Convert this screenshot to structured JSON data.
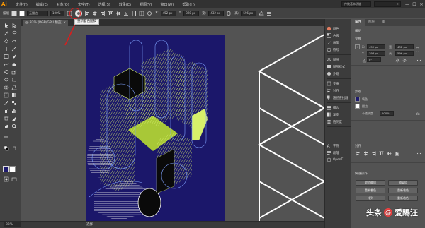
{
  "app": {
    "logo_text": "Ai",
    "menus": [
      "文件(F)",
      "编辑(E)",
      "对象(O)",
      "文字(T)",
      "选择(S)",
      "效果(C)",
      "视图(V)",
      "窗口(W)",
      "帮助(H)"
    ],
    "workspace": "传统基本功能",
    "window_controls": [
      "—",
      "☐",
      "✕"
    ]
  },
  "controlbar": {
    "label": "编组",
    "stroke_profile": "无描边",
    "opacity": "100%",
    "x": "452 px",
    "y": "398 px",
    "w": "432 px",
    "h": "596 px"
  },
  "tooltip": "重新着色图稿",
  "document_tab": {
    "title": "@ 33% (RGB/GPU 预览)",
    "close": "×"
  },
  "status": {
    "zoom": "33%",
    "tool": "选择"
  },
  "dock": {
    "items": [
      "颜色",
      "色板",
      "画笔",
      "符号",
      "图层",
      "图形样式",
      "外观",
      "变换",
      "对齐",
      "路径查找器",
      "描边",
      "渐变",
      "透明度",
      "字符",
      "段落",
      "OpenT..."
    ]
  },
  "props": {
    "tabs": [
      "属性",
      "图层",
      "库"
    ],
    "section_group": "编组",
    "section_transform": "变换",
    "transform": {
      "x_label": "X:",
      "x": "452 px",
      "y_label": "Y:",
      "y": "398 px",
      "w_label": "宽:",
      "w": "432 px",
      "h_label": "高:",
      "h": "596 px",
      "angle": "0°"
    },
    "section_appearance": "外观",
    "fill_label": "填色",
    "stroke_label": "描边",
    "opacity_label": "不透明度",
    "opacity": "100%",
    "section_align": "对齐",
    "section_quick": "快速操作",
    "buttons": [
      "取消编组",
      "隔离组",
      "重新着色",
      "重新着色",
      "排列",
      "重新着色",
      "重新着色",
      "重新着色"
    ]
  },
  "watermark": {
    "text_left": "头条",
    "badge": "@",
    "text_right": "爱踢汪"
  },
  "colors": {
    "artboard": "#1b176a",
    "artwork_lines": "#d7f06a",
    "accent_red": "#d81e1e"
  }
}
